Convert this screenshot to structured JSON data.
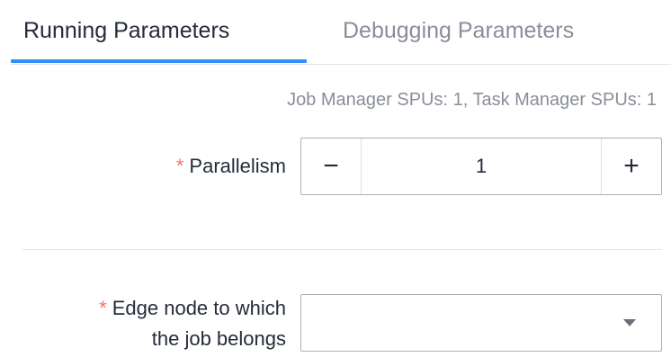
{
  "tabs": [
    {
      "label": "Running Parameters",
      "active": true
    },
    {
      "label": "Debugging Parameters",
      "active": false
    }
  ],
  "resource_info": "Job Manager SPUs: 1, Task Manager SPUs: 1",
  "form": {
    "required_mark": "*",
    "parallelism": {
      "label": "Parallelism",
      "value": "1",
      "minus_symbol": "−",
      "plus_symbol": "+"
    },
    "edge_node": {
      "label_line1": "Edge node to which",
      "label_line2": "the job belongs",
      "value": ""
    }
  },
  "colors": {
    "accent": "#2f8ff5",
    "required": "#f66f6a",
    "muted_text": "#8a8e99",
    "text": "#252b3a",
    "border": "#adb0b8"
  }
}
